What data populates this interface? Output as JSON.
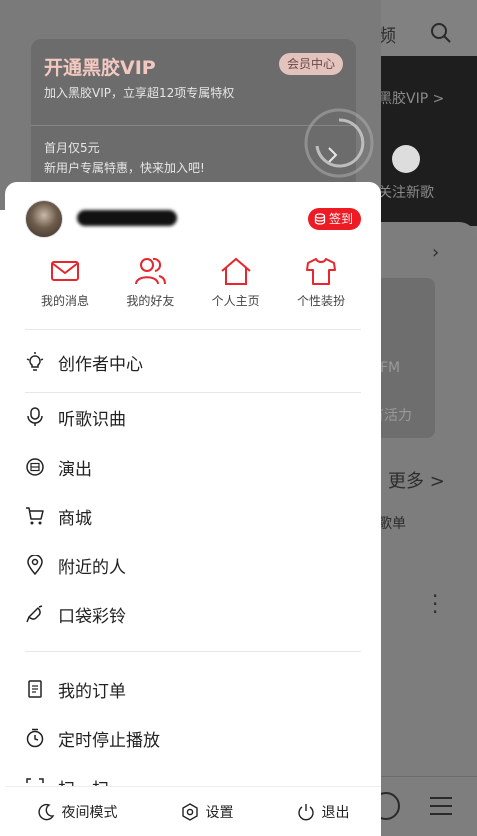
{
  "background": {
    "tab_partial": "频",
    "banner_text": "黑胶VIP >",
    "banner_item": "关注新歌",
    "fm_text": "FM",
    "fm_text2": "有活力",
    "more_label": "更多 >",
    "songlist_label": "歌单"
  },
  "vip": {
    "title": "开通黑胶VIP",
    "subtitle": "加入黑胶VIP，立享超12项专属特权",
    "badge": "会员中心",
    "offer_line1": "首月仅5元",
    "offer_line2": "新用户专属特惠，快来加入吧!"
  },
  "profile": {
    "signin_label": "签到"
  },
  "quick_actions": [
    {
      "label": "我的消息",
      "icon": "mail-icon"
    },
    {
      "label": "我的好友",
      "icon": "friends-icon"
    },
    {
      "label": "个人主页",
      "icon": "home-icon"
    },
    {
      "label": "个性装扮",
      "icon": "tshirt-icon"
    }
  ],
  "menu": {
    "creator": "创作者中心",
    "recognize": "听歌识曲",
    "shows": "演出",
    "mall": "商城",
    "nearby": "附近的人",
    "ringtone": "口袋彩铃",
    "orders": "我的订单",
    "timer": "定时停止播放",
    "scan": "扫一扫"
  },
  "footer": {
    "night_mode": "夜间模式",
    "settings": "设置",
    "logout": "退出"
  },
  "colors": {
    "accent": "#ee1b24"
  }
}
